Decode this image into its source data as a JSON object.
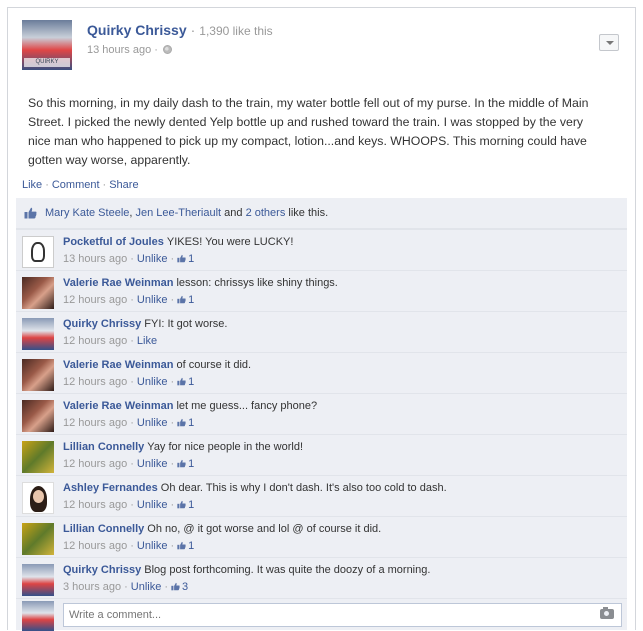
{
  "post": {
    "author": "Quirky Chrissy",
    "separator": "·",
    "page_likes": "1,390 like this",
    "time": "13 hours ago",
    "meta_dot": "·",
    "avatar_caption": "QUIRKY CHRISSY",
    "text": "So this morning, in my daily dash to the train, my water bottle fell out of my purse. In the middle of Main Street. I picked the newly dented Yelp bottle up and rushed toward the train. I was stopped by the very nice man who happened to pick up my compact, lotion...and keys. WHOOPS. This morning could have gotten way worse, apparently."
  },
  "actions": {
    "like": "Like",
    "comment": "Comment",
    "share": "Share",
    "dot": "·"
  },
  "likes": {
    "name1": "Mary Kate Steele",
    "comma": ", ",
    "name2": "Jen Lee-Theriault",
    "and": " and ",
    "others": "2 others",
    "suffix": " like this."
  },
  "comments": [
    {
      "author": "Pocketful of Joules",
      "text": "YIKES! You were LUCKY!",
      "time": "13 hours ago",
      "action": "Unlike",
      "likes": "1"
    },
    {
      "author": "Valerie Rae Weinman",
      "text": "lesson: chrissys like shiny things.",
      "time": "12 hours ago",
      "action": "Unlike",
      "likes": "1"
    },
    {
      "author": "Quirky Chrissy",
      "text": "FYI: It got worse.",
      "time": "12 hours ago",
      "action": "Like",
      "likes": ""
    },
    {
      "author": "Valerie Rae Weinman",
      "text": "of course it did.",
      "time": "12 hours ago",
      "action": "Unlike",
      "likes": "1"
    },
    {
      "author": "Valerie Rae Weinman",
      "text": "let me guess... fancy phone?",
      "time": "12 hours ago",
      "action": "Unlike",
      "likes": "1"
    },
    {
      "author": "Lillian Connelly",
      "text": "Yay for nice people in the world!",
      "time": "12 hours ago",
      "action": "Unlike",
      "likes": "1"
    },
    {
      "author": "Ashley Fernandes",
      "text": "Oh dear. This is why I don't dash. It's also too cold to dash.",
      "time": "12 hours ago",
      "action": "Unlike",
      "likes": "1"
    },
    {
      "author": "Lillian Connelly",
      "text": "Oh no, @ it got worse and lol @ of course it did.",
      "time": "12 hours ago",
      "action": "Unlike",
      "likes": "1"
    },
    {
      "author": "Quirky Chrissy",
      "text": "Blog post forthcoming. It was quite the doozy of a morning.",
      "time": "3 hours ago",
      "action": "Unlike",
      "likes": "3"
    }
  ],
  "comment_box": {
    "placeholder": "Write a comment..."
  },
  "icons": {
    "menu": "chevron-down-icon",
    "privacy": "globe-icon",
    "like": "thumbs-up-icon",
    "camera": "camera-icon"
  },
  "colors": {
    "link": "#3b5998",
    "ufi_background": "#edeff4",
    "meta_text": "#999999"
  }
}
